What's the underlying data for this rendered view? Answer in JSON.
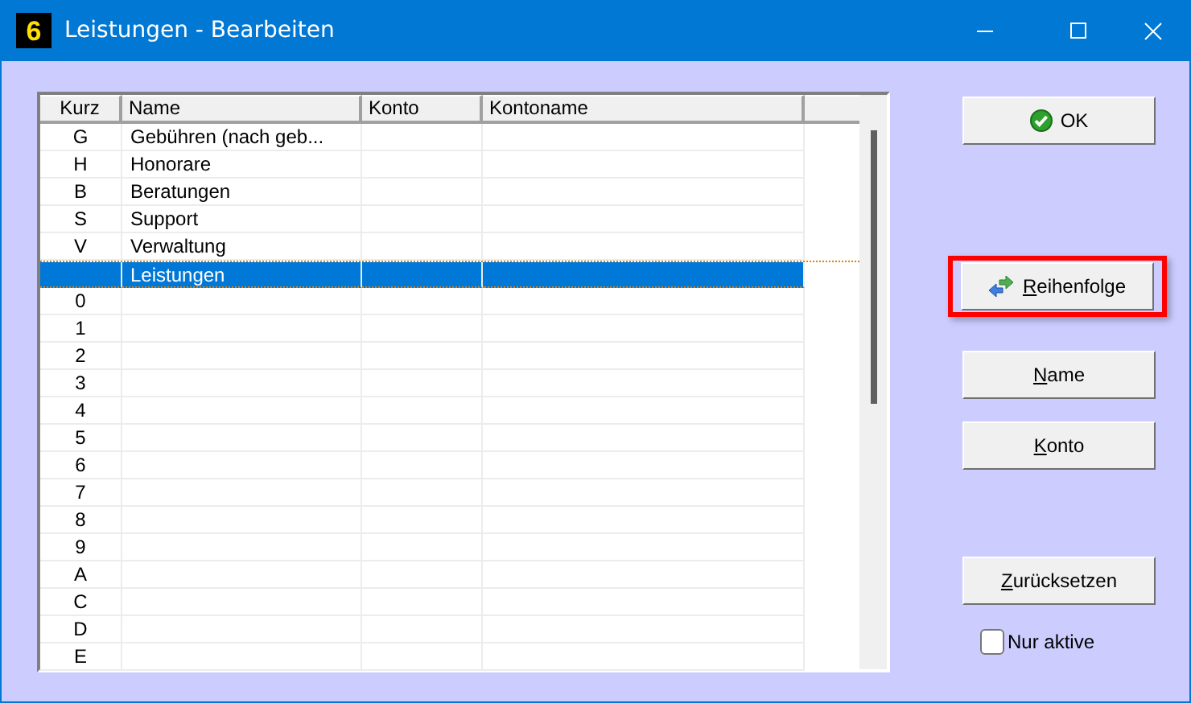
{
  "window": {
    "title": "Leistungen - Bearbeiten",
    "icon_text": "6"
  },
  "table": {
    "columns": [
      "Kurz",
      "Name",
      "Konto",
      "Kontoname"
    ],
    "rows": [
      {
        "kurz": "G",
        "name": "Gebühren (nach geb...",
        "selected": false
      },
      {
        "kurz": "H",
        "name": "Honorare",
        "selected": false
      },
      {
        "kurz": "B",
        "name": "Beratungen",
        "selected": false
      },
      {
        "kurz": "S",
        "name": "Support",
        "selected": false
      },
      {
        "kurz": "V",
        "name": "Verwaltung",
        "selected": false
      },
      {
        "name": "Leistungen",
        "selected": true
      },
      {
        "kurz": "0",
        "selected": false
      },
      {
        "kurz": "1",
        "selected": false
      },
      {
        "kurz": "2",
        "selected": false
      },
      {
        "kurz": "3",
        "selected": false
      },
      {
        "kurz": "4",
        "selected": false
      },
      {
        "kurz": "5",
        "selected": false
      },
      {
        "kurz": "6",
        "selected": false
      },
      {
        "kurz": "7",
        "selected": false
      },
      {
        "kurz": "8",
        "selected": false
      },
      {
        "kurz": "9",
        "selected": false
      },
      {
        "kurz": "A",
        "selected": false
      },
      {
        "kurz": "C",
        "selected": false
      },
      {
        "kurz": "D",
        "selected": false
      },
      {
        "kurz": "E",
        "selected": false
      }
    ]
  },
  "buttons": [
    {
      "kind": "ok",
      "label": "OK",
      "highlighted": false
    },
    {
      "kind": "order",
      "label": "Reihenfolge",
      "mnemonic": true,
      "highlighted": true
    },
    {
      "kind": "plain",
      "label": "Name",
      "mnemonic": true,
      "highlighted": false
    },
    {
      "kind": "plain",
      "label": "Konto",
      "mnemonic": true,
      "highlighted": false
    },
    {
      "kind": "plain",
      "label": "Zurücksetzen",
      "mnemonic": true,
      "highlighted": false
    }
  ],
  "filter": {
    "label": "Nur aktive",
    "checked": false
  }
}
